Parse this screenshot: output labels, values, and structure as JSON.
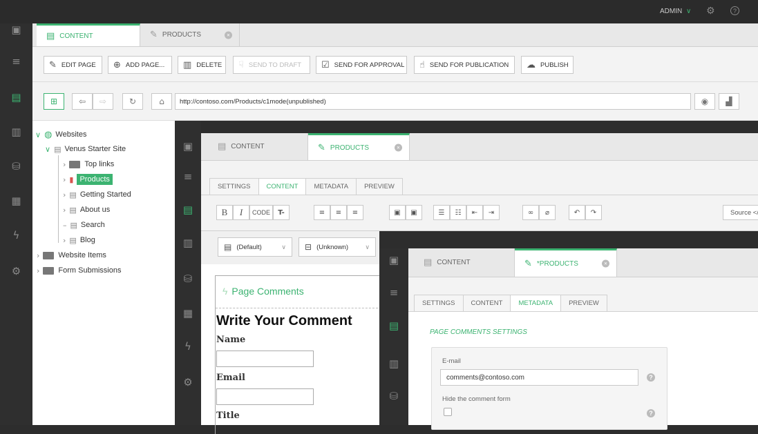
{
  "topbar": {
    "user": "ADMIN",
    "user_chevron": "∨",
    "settings_icon": "gear-icon",
    "help_icon": "question-icon"
  },
  "colors": {
    "accent": "#3cb371",
    "rail": "#2f2f2f"
  },
  "rail": {
    "logo": "C1",
    "icons": [
      "menu-icon",
      "content-icon",
      "media-icon",
      "data-icon",
      "layout-icon",
      "function-icon",
      "settings-icon"
    ]
  },
  "window1": {
    "tabs": [
      {
        "label": "CONTENT"
      },
      {
        "label": "PRODUCTS"
      }
    ],
    "toolbar": {
      "edit_page": "EDIT PAGE",
      "add_page": "ADD PAGE...",
      "delete": "DELETE",
      "send_to_draft": "SEND TO DRAFT",
      "send_for_approval": "SEND FOR APPROVAL",
      "send_for_publication": "SEND FOR PUBLICATION",
      "publish": "PUBLISH"
    },
    "address": "http://contoso.com/Products/c1mode(unpublished)",
    "tree": {
      "websites": "Websites",
      "site": "Venus Starter Site",
      "top_links": "Top links",
      "products": "Products",
      "getting_started": "Getting Started",
      "about_us": "About us",
      "search": "Search",
      "blog": "Blog",
      "website_items": "Website Items",
      "form_submissions": "Form Submissions"
    }
  },
  "window2": {
    "tabs": [
      {
        "label": "CONTENT"
      },
      {
        "label": "PRODUCTS"
      }
    ],
    "subtabs": [
      "SETTINGS",
      "CONTENT",
      "METADATA",
      "PREVIEW"
    ],
    "format": {
      "bold": "B",
      "italic": "I",
      "code": "CODE",
      "clear": "T-"
    },
    "source": "Source </",
    "template_select": "(Default)",
    "type_select": "(Unknown)",
    "doc": {
      "page_comments": "Page Comments",
      "heading": "Write Your Comment",
      "name_label": "Name",
      "email_label": "Email",
      "title_label": "Title"
    }
  },
  "window3": {
    "tabs": [
      {
        "label": "CONTENT"
      },
      {
        "label": "*PRODUCTS"
      }
    ],
    "subtabs": [
      "SETTINGS",
      "CONTENT",
      "METADATA",
      "PREVIEW"
    ],
    "section_title": "PAGE COMMENTS SETTINGS",
    "email_label": "E-mail",
    "email_value": "comments@contoso.com",
    "hide_form_label": "Hide the comment form",
    "hide_form_checked": false
  }
}
